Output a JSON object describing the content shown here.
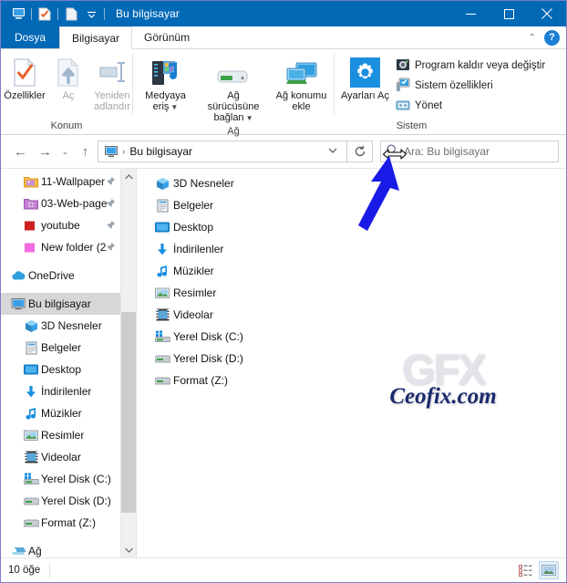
{
  "titlebar": {
    "title": "Bu bilgisayar",
    "qat_icons": [
      "this-pc-icon",
      "properties-icon",
      "new-folder-icon",
      "customize-qat-caret"
    ],
    "minimize_label": "—",
    "maximize_label": "□",
    "close_label": "✕"
  },
  "tabs": [
    {
      "label": "Dosya",
      "state": "file-menu"
    },
    {
      "label": "Bilgisayar",
      "state": "active"
    },
    {
      "label": "Görünüm",
      "state": "inactive"
    }
  ],
  "tab_right": {
    "collapse_ribbon": "⌃",
    "help": "?"
  },
  "ribbon": {
    "groups": [
      {
        "label": "Konum",
        "buttons": [
          {
            "label": "Özellikler",
            "icon": "properties-icon",
            "disabled": false,
            "split": false
          },
          {
            "label": "Aç",
            "icon": "open-icon",
            "disabled": true,
            "split": false
          },
          {
            "label": "Yeniden adlandır",
            "icon": "rename-icon",
            "disabled": true,
            "split": false
          }
        ]
      },
      {
        "label": "Ağ",
        "buttons": [
          {
            "label": "Medyaya eriş",
            "icon": "media-server-icon",
            "disabled": false,
            "split": true
          },
          {
            "label": "Ağ sürücüsüne bağlan",
            "icon": "map-network-drive-icon",
            "disabled": false,
            "split": true
          },
          {
            "label": "Ağ konumu ekle",
            "icon": "add-network-location-icon",
            "disabled": false,
            "split": false
          }
        ]
      },
      {
        "label": "Sistem",
        "big_button": {
          "label": "Ayarları Aç",
          "icon": "settings-gear-icon"
        },
        "small_buttons": [
          {
            "label": "Program kaldır veya değiştir",
            "icon": "uninstall-program-icon"
          },
          {
            "label": "Sistem özellikleri",
            "icon": "system-properties-icon"
          },
          {
            "label": "Yönet",
            "icon": "manage-computer-icon"
          }
        ]
      }
    ]
  },
  "addressbar": {
    "back": "←",
    "forward": "→",
    "recent": "⌄",
    "up": "↑",
    "crumb_icon": "this-pc-icon",
    "crumb_separator": "›",
    "crumb_text": "Bu bilgisayar",
    "dropdown_caret": "⌄",
    "refresh": "↻",
    "resize_cursor": "horizontal-resize-cursor",
    "search_icon": "search-icon",
    "search_placeholder": "Ara: Bu bilgisayar",
    "search_value": ""
  },
  "navpane": {
    "items": [
      {
        "label": "11-Wallpaper",
        "icon": "folder-pictures-icon",
        "pinned": true,
        "indent": true,
        "selected": false
      },
      {
        "label": "03-Web-page",
        "icon": "folder-web-icon",
        "pinned": true,
        "indent": true,
        "selected": false
      },
      {
        "label": "youtube",
        "icon": "folder-red-icon",
        "pinned": true,
        "indent": true,
        "selected": false
      },
      {
        "label": "New folder (2",
        "icon": "folder-pink-icon",
        "pinned": true,
        "indent": true,
        "selected": false
      },
      {
        "label": "OneDrive",
        "icon": "onedrive-icon",
        "pinned": false,
        "indent": false,
        "selected": false
      },
      {
        "label": "Bu bilgisayar",
        "icon": "this-pc-icon",
        "pinned": false,
        "indent": false,
        "selected": true
      },
      {
        "label": "3D Nesneler",
        "icon": "3d-objects-icon",
        "pinned": false,
        "indent": true,
        "selected": false
      },
      {
        "label": "Belgeler",
        "icon": "documents-icon",
        "pinned": false,
        "indent": true,
        "selected": false
      },
      {
        "label": "Desktop",
        "icon": "desktop-icon",
        "pinned": false,
        "indent": true,
        "selected": false
      },
      {
        "label": "İndirilenler",
        "icon": "downloads-icon",
        "pinned": false,
        "indent": true,
        "selected": false
      },
      {
        "label": "Müzikler",
        "icon": "music-icon",
        "pinned": false,
        "indent": true,
        "selected": false
      },
      {
        "label": "Resimler",
        "icon": "pictures-icon",
        "pinned": false,
        "indent": true,
        "selected": false
      },
      {
        "label": "Videolar",
        "icon": "videos-icon",
        "pinned": false,
        "indent": true,
        "selected": false
      },
      {
        "label": "Yerel Disk (C:)",
        "icon": "system-drive-icon",
        "pinned": false,
        "indent": true,
        "selected": false
      },
      {
        "label": "Yerel Disk (D:)",
        "icon": "drive-icon",
        "pinned": false,
        "indent": true,
        "selected": false
      },
      {
        "label": "Format (Z:)",
        "icon": "drive-icon",
        "pinned": false,
        "indent": true,
        "selected": false
      },
      {
        "label": "Ağ",
        "icon": "network-icon",
        "pinned": false,
        "indent": false,
        "selected": false
      }
    ],
    "scroll_up": "⌃",
    "scroll_down": "⌄"
  },
  "filelist": {
    "items": [
      {
        "label": "3D Nesneler",
        "icon": "3d-objects-icon"
      },
      {
        "label": "Belgeler",
        "icon": "documents-icon"
      },
      {
        "label": "Desktop",
        "icon": "desktop-icon"
      },
      {
        "label": "İndirilenler",
        "icon": "downloads-icon"
      },
      {
        "label": "Müzikler",
        "icon": "music-icon"
      },
      {
        "label": "Resimler",
        "icon": "pictures-icon"
      },
      {
        "label": "Videolar",
        "icon": "videos-icon"
      },
      {
        "label": "Yerel Disk (C:)",
        "icon": "system-drive-icon"
      },
      {
        "label": "Yerel Disk (D:)",
        "icon": "drive-icon"
      },
      {
        "label": "Format (Z:)",
        "icon": "drive-icon"
      }
    ]
  },
  "watermark": {
    "logo_text": "GFX",
    "site_text": "Ceofix.com",
    "annotation_arrow": "blue-arrow-annotation"
  },
  "statusbar": {
    "count_text": "10 öğe",
    "view_details": "details-view-icon",
    "view_large": "large-icons-view-icon"
  },
  "colors": {
    "titlebar": "#0169b6",
    "file_tab": "#0169b6",
    "selection": "#d7d7d7",
    "accent_blue": "#1a7fd4",
    "arrow_blue": "#1a1ae6",
    "watermark_navy": "#1b2a6b",
    "window_border": "#7a7fc4"
  }
}
